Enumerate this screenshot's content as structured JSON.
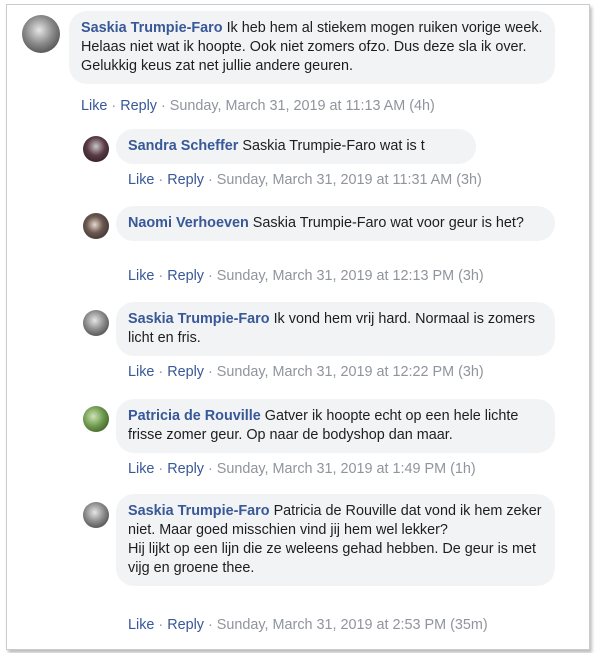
{
  "comments": [
    {
      "author": "Saskia Trumpie-Faro",
      "text": "Ik heb hem al stiekem mogen ruiken vorige week. Helaas niet wat ik hoopte. Ook niet zomers ofzo. Dus deze sla ik over. Gelukkig keus zat net jullie andere geuren.",
      "like": "Like",
      "reply": "Reply",
      "time": "Sunday, March 31, 2019 at 11:13 AM (4h)"
    },
    {
      "author": "Sandra Scheffer",
      "text": "Saskia Trumpie-Faro wat is t",
      "like": "Like",
      "reply": "Reply",
      "time": "Sunday, March 31, 2019 at 11:31 AM (3h)"
    },
    {
      "author": "Naomi Verhoeven",
      "text": "Saskia Trumpie-Faro wat voor geur is het?",
      "like": "Like",
      "reply": "Reply",
      "time": "Sunday, March 31, 2019 at 12:13 PM (3h)"
    },
    {
      "author": "Saskia Trumpie-Faro",
      "text": "Ik vond hem vrij hard. Normaal is zomers licht en fris.",
      "like": "Like",
      "reply": "Reply",
      "time": "Sunday, March 31, 2019 at 12:22 PM (3h)"
    },
    {
      "author": "Patricia de Rouville",
      "text": "Gatver ik hoopte echt op een hele lichte frisse zomer geur. Op naar de bodyshop dan maar.",
      "like": "Like",
      "reply": "Reply",
      "time": "Sunday, March 31, 2019 at 1:49 PM (1h)"
    },
    {
      "author": "Saskia Trumpie-Faro",
      "text": "Patricia de Rouville dat vond ik hem zeker niet. Maar goed misschien vind jij hem wel lekker?\nHij lijkt op een lijn die ze weleens gehad hebben. De geur is met vijg en groene thee.",
      "like": "Like",
      "reply": "Reply",
      "time": "Sunday, March 31, 2019 at 2:53 PM (35m)"
    }
  ],
  "icons": {
    "avatar": "profile-photo"
  }
}
